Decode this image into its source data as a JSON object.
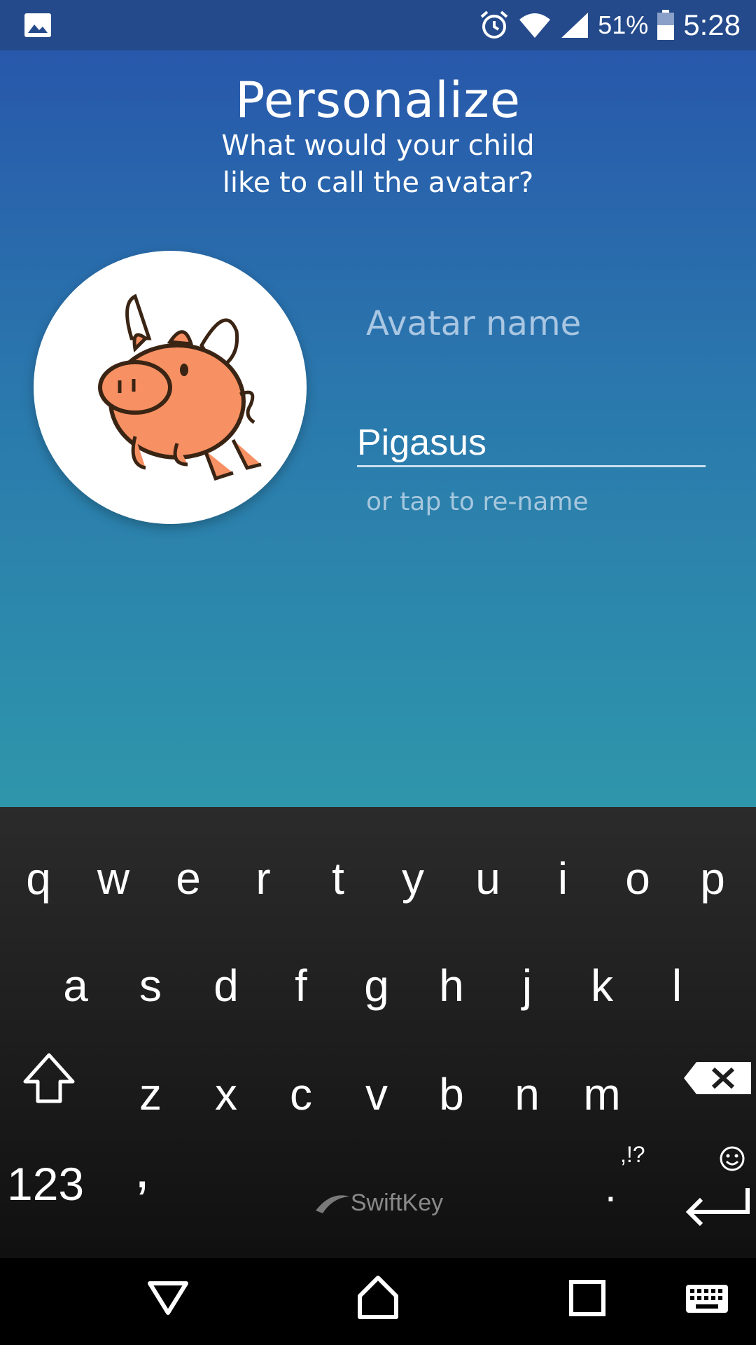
{
  "status_bar": {
    "battery_percent": "51%",
    "time": "5:28",
    "icons": [
      "gallery-icon",
      "alarm-icon",
      "wifi-icon",
      "signal-icon",
      "battery-icon"
    ]
  },
  "header": {
    "title": "Personalize",
    "subtitle_line1": "What would your child",
    "subtitle_line2": "like to call the avatar?"
  },
  "avatar": {
    "image": "flying-pig-avatar",
    "field_label": "Avatar name",
    "name_value": "Pigasus",
    "hint": "or tap to re-name"
  },
  "keyboard": {
    "row1": [
      "q",
      "w",
      "e",
      "r",
      "t",
      "y",
      "u",
      "i",
      "o",
      "p"
    ],
    "row2": [
      "a",
      "s",
      "d",
      "f",
      "g",
      "h",
      "j",
      "k",
      "l"
    ],
    "row3": [
      "z",
      "x",
      "c",
      "v",
      "b",
      "n",
      "m"
    ],
    "numbers_key": "123",
    "comma_key": ",",
    "space_brand": "SwiftKey",
    "punct_hint": ",!?",
    "period_key": "."
  },
  "colors": {
    "gradient_top": "#2858ab",
    "gradient_bottom": "#2e96ab",
    "pig_body": "#f79163"
  }
}
